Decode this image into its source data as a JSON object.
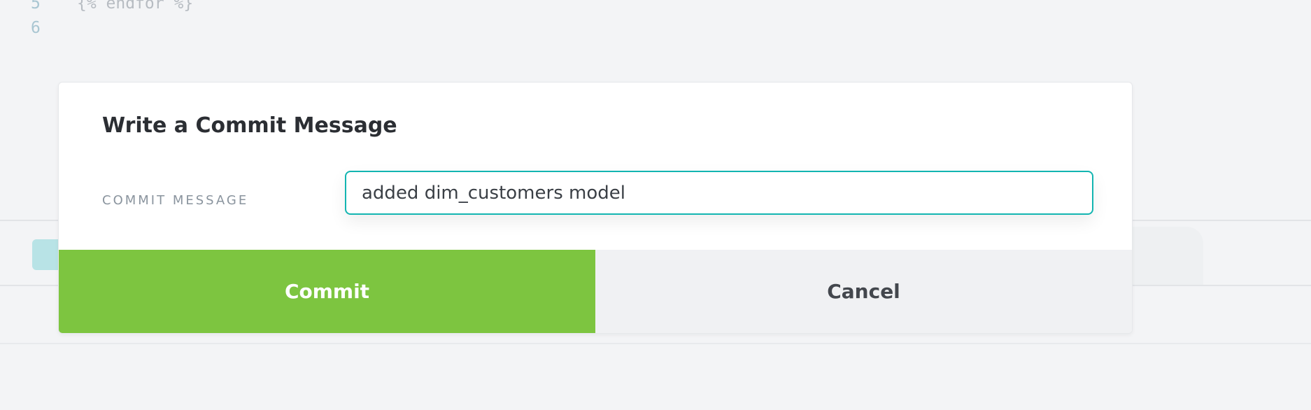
{
  "editor": {
    "lines": [
      {
        "number": "5",
        "code": "{% endfor %}"
      },
      {
        "number": "6",
        "code": ""
      }
    ]
  },
  "modal": {
    "title": "Write a Commit Message",
    "field_label": "COMMIT MESSAGE",
    "input_value": "added dim_customers model",
    "commit_label": "Commit",
    "cancel_label": "Cancel"
  },
  "colors": {
    "accent": "#13b5b1",
    "commit_button": "#7dc540",
    "cancel_button": "#f0f1f3"
  }
}
